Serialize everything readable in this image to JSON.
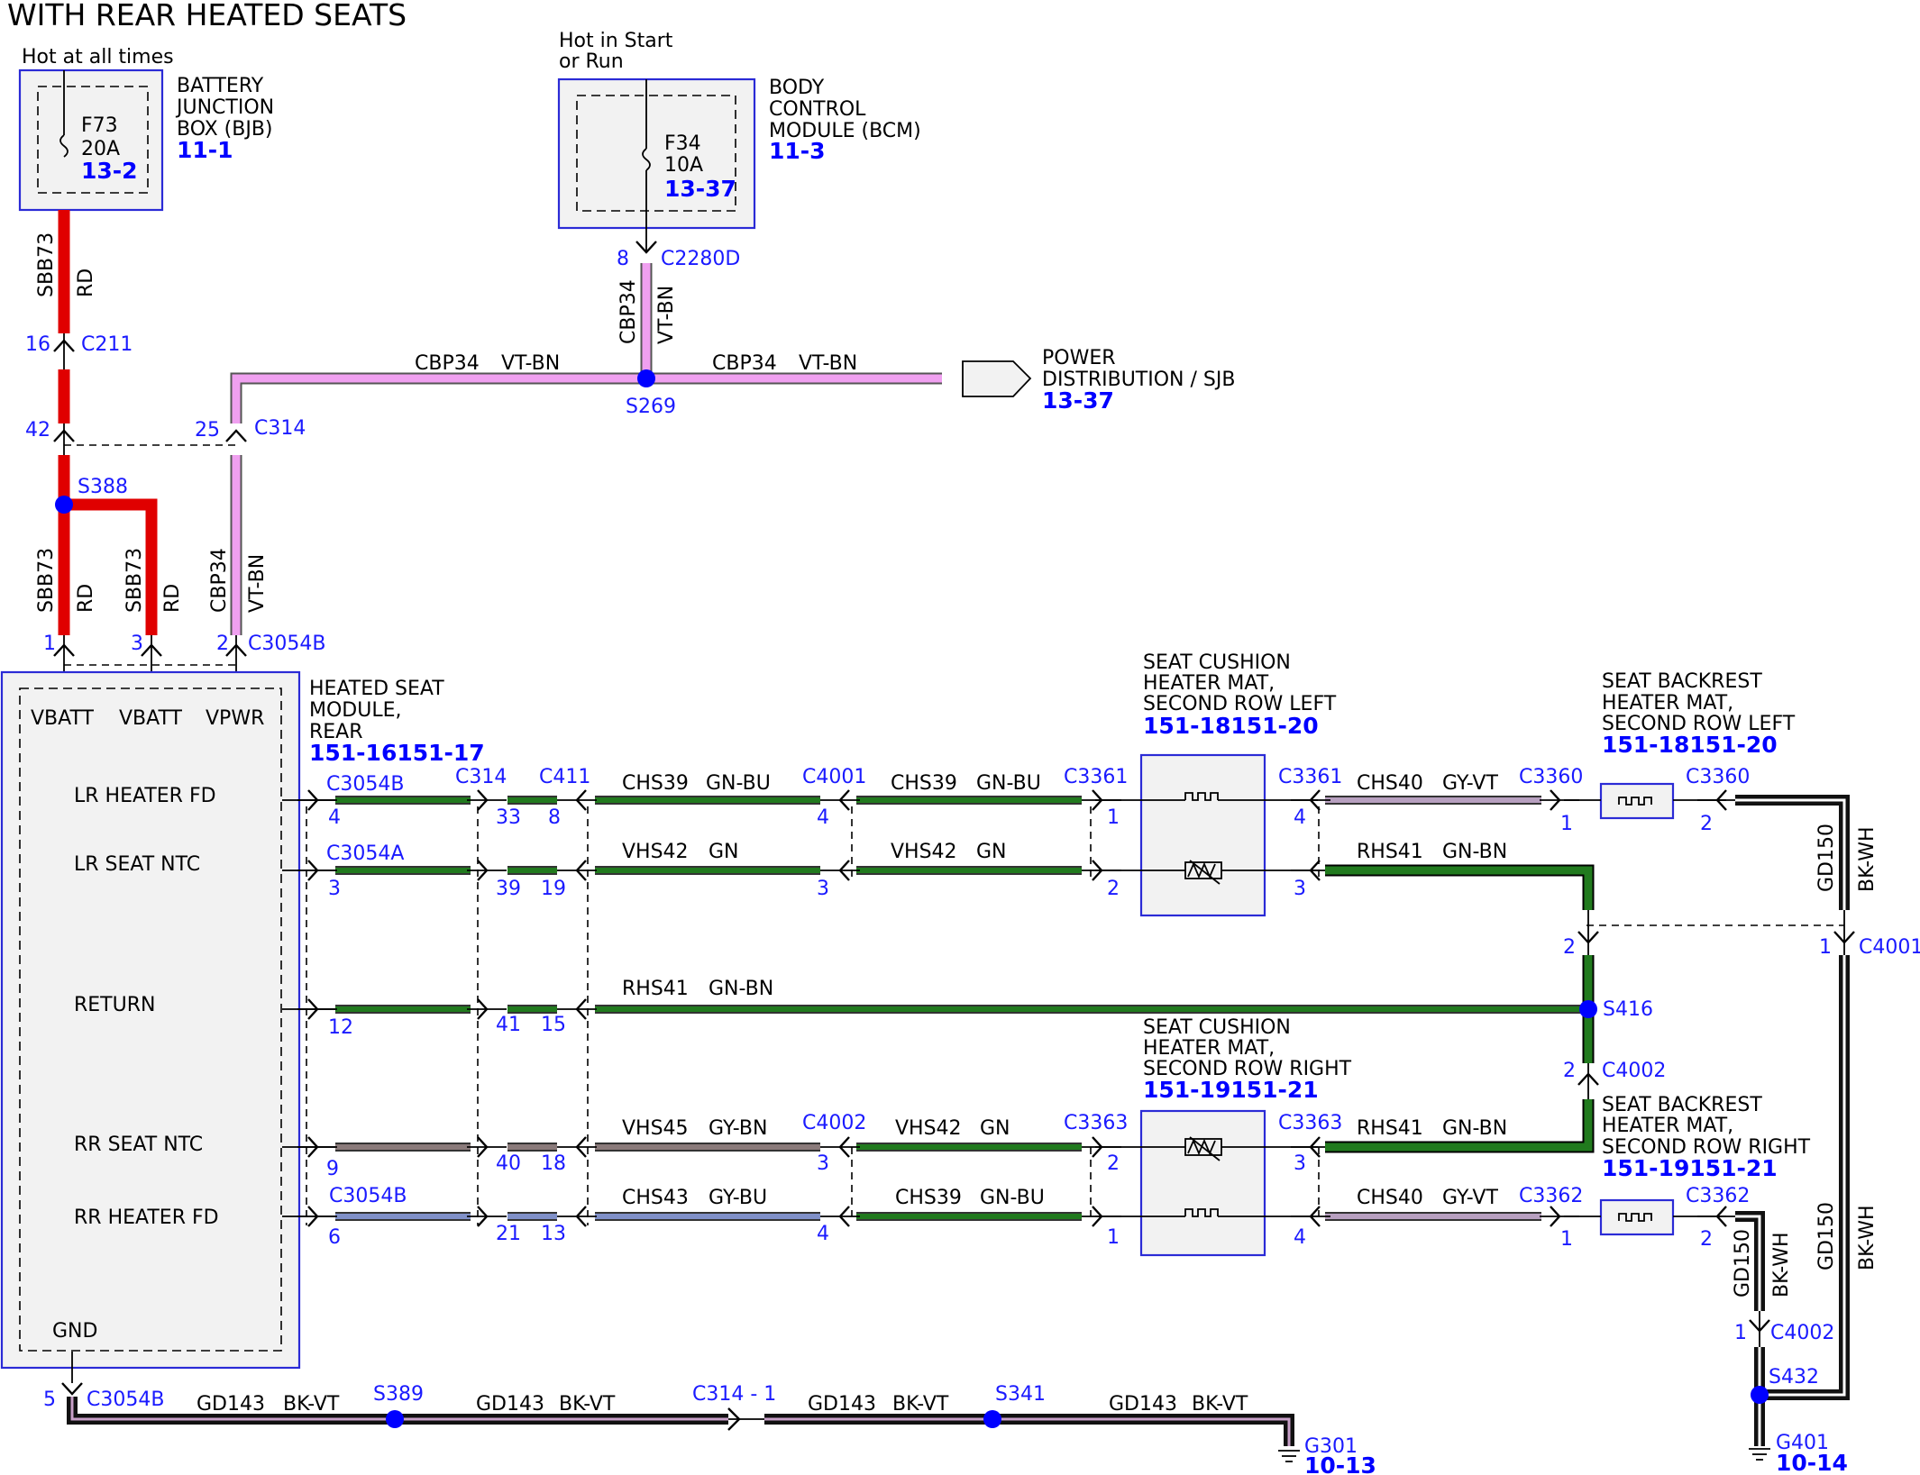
{
  "title": "WITH REAR HEATED SEATS",
  "colors": {
    "red": "#e00000",
    "violet": "#f0a0f0",
    "green": "#217a1e",
    "grey_brown": "#8a7a7a",
    "grey_blue": "#8090c8",
    "grey_violet": "#b8a0c0",
    "black": "#111111",
    "splice_blue": "#0000ff"
  },
  "bjb": {
    "hot": "Hot at all times",
    "fuse": "F73",
    "amp": "20A",
    "ref": "13-2",
    "name1": "BATTERY",
    "name2": "JUNCTION",
    "name3": "BOX (BJB)",
    "page": "11-1"
  },
  "bcm": {
    "hot1": "Hot in Start",
    "hot2": "or Run",
    "fuse": "F34",
    "amp": "10A",
    "ref": "13-37",
    "name1": "BODY",
    "name2": "CONTROL",
    "name3": "MODULE (BCM)",
    "page": "11-3"
  },
  "pdist": {
    "name1": "POWER",
    "name2": "DISTRIBUTION / SJB",
    "ref": "13-37"
  },
  "module": {
    "name1": "HEATED SEAT",
    "name2": "MODULE,",
    "name3": "REAR",
    "ref": "151-16151-17",
    "vbatt1": "VBATT",
    "vbatt2": "VBATT",
    "vpwr": "VPWR",
    "lr_heater": "LR HEATER FD",
    "lr_ntc": "LR SEAT NTC",
    "return": "RETURN",
    "rr_ntc": "RR SEAT NTC",
    "rr_heater": "RR HEATER FD",
    "gnd": "GND"
  },
  "cushion_left": {
    "n1": "SEAT CUSHION",
    "n2": "HEATER MAT,",
    "n3": "SECOND ROW LEFT",
    "ref": "151-18151-20"
  },
  "backrest_left": {
    "n1": "SEAT BACKREST",
    "n2": "HEATER MAT,",
    "n3": "SECOND ROW LEFT",
    "ref": "151-18151-20"
  },
  "cushion_right": {
    "n1": "SEAT CUSHION",
    "n2": "HEATER MAT,",
    "n3": "SECOND ROW RIGHT",
    "ref": "151-19151-21"
  },
  "backrest_right": {
    "n1": "SEAT BACKREST",
    "n2": "HEATER MAT,",
    "n3": "SECOND ROW RIGHT",
    "ref": "151-19151-21"
  },
  "grounds": {
    "g301": "G301",
    "g301_ref": "10-13",
    "g401": "G401",
    "g401_ref": "10-14"
  },
  "w": {
    "sbb73": "SBB73",
    "rd": "RD",
    "cbp34": "CBP34",
    "vtbn": "VT-BN",
    "chs39": "CHS39",
    "gnbu": "GN-BU",
    "vhs42": "VHS42",
    "gn": "GN",
    "rhs41": "RHS41",
    "gnbn": "GN-BN",
    "vhs45": "VHS45",
    "gybn": "GY-BN",
    "chs43": "CHS43",
    "gybu": "GY-BU",
    "chs40": "CHS40",
    "gyvt": "GY-VT",
    "gd143": "GD143",
    "bkvt": "BK-VT",
    "gd150": "GD150",
    "bkwh": "BK-WH"
  },
  "c": {
    "c211": "C211",
    "c314": "C314",
    "c2280d": "C2280D",
    "c3054b": "C3054B",
    "c3054a": "C3054A",
    "c411": "C411",
    "c4001": "C4001",
    "c4002": "C4002",
    "c3361": "C3361",
    "c3360": "C3360",
    "c3363": "C3363",
    "c3362": "C3362",
    "c314_1": "C314 - 1"
  },
  "s": {
    "s388": "S388",
    "s269": "S269",
    "s416": "S416",
    "s389": "S389",
    "s341": "S341",
    "s432": "S432"
  },
  "p": {
    "p16": "16",
    "p42": "42",
    "p25": "25",
    "p8": "8",
    "p1": "1",
    "p3": "3",
    "p2": "2",
    "p4": "4",
    "p33": "33",
    "p39": "39",
    "p19": "19",
    "p12": "12",
    "p41": "41",
    "p15": "15",
    "p9": "9",
    "p40": "40",
    "p18": "18",
    "p6": "6",
    "p21": "21",
    "p13": "13",
    "p5": "5"
  }
}
